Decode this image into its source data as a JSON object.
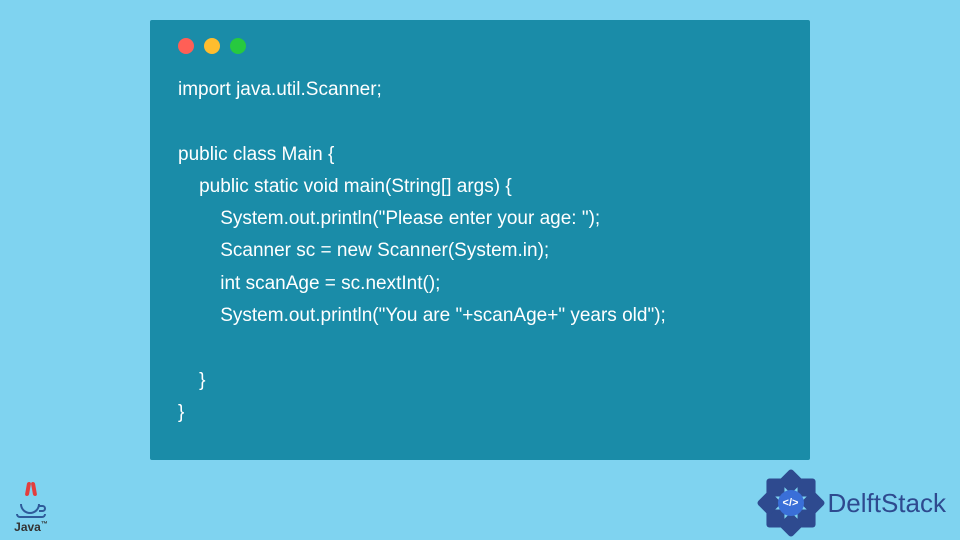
{
  "code": {
    "line1": "import java.util.Scanner;",
    "line2": "",
    "line3": "public class Main {",
    "line4": "    public static void main(String[] args) {",
    "line5": "        System.out.println(\"Please enter your age: \");",
    "line6": "        Scanner sc = new Scanner(System.in);",
    "line7": "        int scanAge = sc.nextInt();",
    "line8": "        System.out.println(\"You are \"+scanAge+\" years old\");",
    "line9": "",
    "line10": "    }",
    "line11": "}"
  },
  "java_logo": {
    "text": "Java",
    "tm": "™"
  },
  "delftstack": {
    "badge": "</>",
    "text": "DelftStack"
  },
  "colors": {
    "background": "#7fd3f0",
    "window": "#1a8ca8",
    "code_text": "#ffffff",
    "brand_blue": "#2e4a8f"
  }
}
